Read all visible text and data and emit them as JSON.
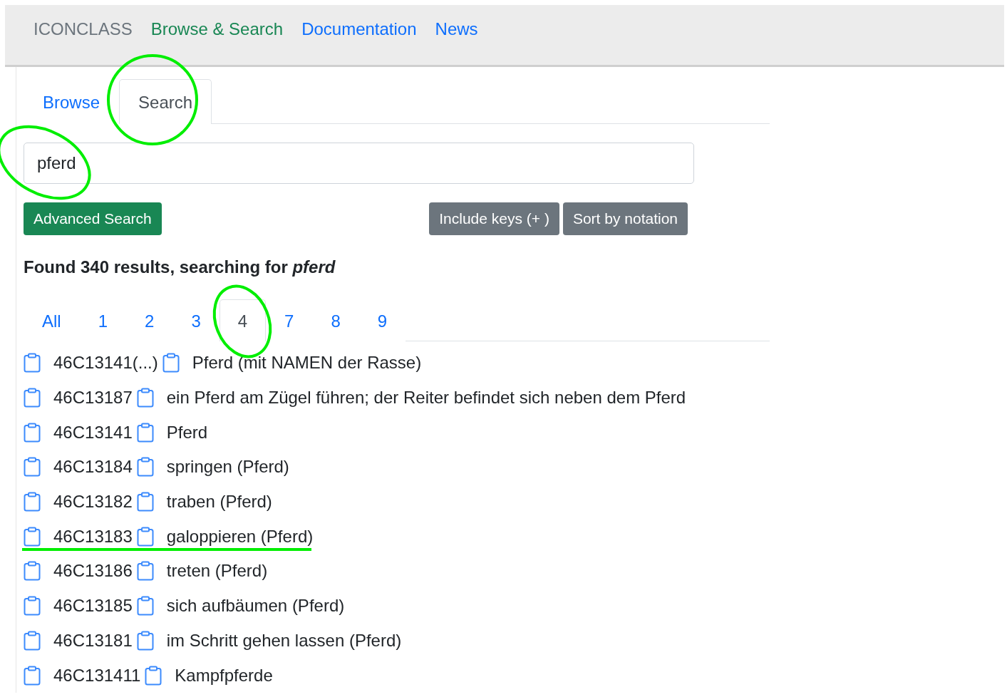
{
  "navbar": {
    "brand": "ICONCLASS",
    "items": [
      {
        "label": "Browse & Search",
        "selected": true
      },
      {
        "label": "Documentation",
        "selected": false
      },
      {
        "label": "News",
        "selected": false
      }
    ]
  },
  "tabs": [
    {
      "label": "Browse",
      "selected": false
    },
    {
      "label": "Search",
      "selected": true
    }
  ],
  "search": {
    "value": "pferd"
  },
  "buttons": {
    "advanced": "Advanced Search",
    "include_keys": "Include keys (+ )",
    "sort": "Sort by notation"
  },
  "result_heading": "Found 340 results, searching for *pferd*",
  "pages": [
    {
      "label": "All",
      "selected": false
    },
    {
      "label": "1",
      "selected": false
    },
    {
      "label": "2",
      "selected": false
    },
    {
      "label": "3",
      "selected": false
    },
    {
      "label": "4",
      "selected": true
    },
    {
      "label": "7",
      "selected": false
    },
    {
      "label": "8",
      "selected": false
    },
    {
      "label": "9",
      "selected": false
    }
  ],
  "results": [
    {
      "notation": "46C13141(...)",
      "text": "Pferd (mit NAMEN der Rasse)"
    },
    {
      "notation": "46C13187",
      "text": "ein Pferd am Zügel führen; der Reiter befindet sich neben dem Pferd"
    },
    {
      "notation": "46C13141",
      "text": "Pferd"
    },
    {
      "notation": "46C13184",
      "text": "springen (Pferd)"
    },
    {
      "notation": "46C13182",
      "text": "traben (Pferd)"
    },
    {
      "notation": "46C13183",
      "text": "galoppieren (Pferd)"
    },
    {
      "notation": "46C13186",
      "text": "treten (Pferd)"
    },
    {
      "notation": "46C13185",
      "text": "sich aufbäumen (Pferd)"
    },
    {
      "notation": "46C13181",
      "text": "im Schritt gehen lassen (Pferd)"
    },
    {
      "notation": "46C131411",
      "text": "Kampfpferde"
    }
  ]
}
